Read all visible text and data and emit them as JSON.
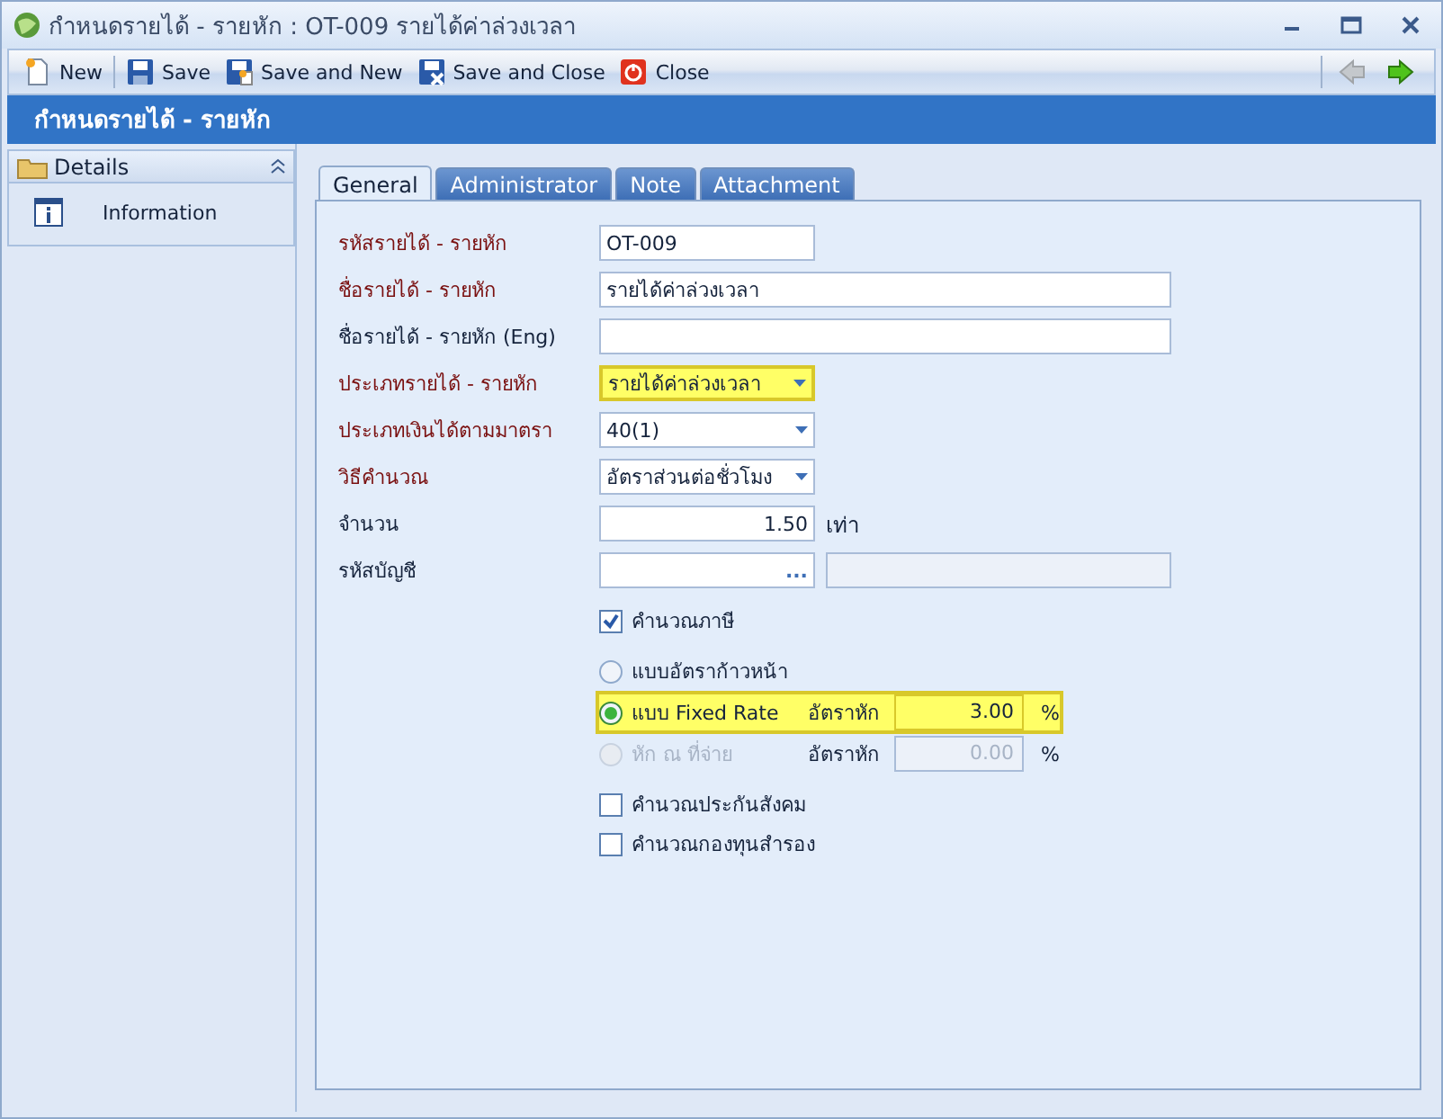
{
  "window": {
    "title": "กำหนดรายได้ - รายหัก : OT-009 รายได้ค่าล่วงเวลา"
  },
  "toolbar": {
    "buttons": [
      {
        "label": "New",
        "kind": "new"
      },
      {
        "label": "Save",
        "kind": "save"
      },
      {
        "label": "Save and New",
        "kind": "save-new"
      },
      {
        "label": "Save and Close",
        "kind": "save-close"
      },
      {
        "label": "Close",
        "kind": "close"
      }
    ],
    "nav": [
      {
        "kind": "back",
        "disabled": true
      },
      {
        "kind": "forward",
        "disabled": false
      }
    ]
  },
  "header": {
    "title": "กำหนดรายได้ - รายหัก"
  },
  "sidebar": {
    "group": "Details",
    "items": [
      {
        "label": "Information"
      }
    ]
  },
  "tabs": [
    {
      "label": "General",
      "selected": true
    },
    {
      "label": "Administrator",
      "selected": false
    },
    {
      "label": "Note",
      "selected": false
    },
    {
      "label": "Attachment",
      "selected": false
    }
  ],
  "fields": [
    {
      "label": "รหัสรายได้ - รายหัก",
      "required": true,
      "kind": "code",
      "value": "OT-009",
      "highlighted": false
    },
    {
      "label": "ชื่อรายได้ - รายหัก",
      "required": true,
      "kind": "text",
      "value": "รายได้ค่าล่วงเวลา",
      "highlighted": false
    },
    {
      "label": "ชื่อรายได้ - รายหัก (Eng)",
      "required": false,
      "kind": "text",
      "highlighted": false
    },
    {
      "label": "ประเภทรายได้ - รายหัก",
      "required": true,
      "kind": "combo",
      "value": "รายได้ค่าล่วงเวลา",
      "highlighted": true
    },
    {
      "label": "ประเภทเงินได้ตามมาตรา",
      "required": true,
      "kind": "combo",
      "value": "40(1)",
      "highlighted": false
    },
    {
      "label": "วิธีคำนวณ",
      "required": true,
      "kind": "combo",
      "value": "อัตราส่วนต่อชั่วโมง",
      "highlighted": false
    },
    {
      "label": "จำนวน",
      "required": false,
      "kind": "number",
      "value": "1.50",
      "unit": "เท่า",
      "highlighted": false
    },
    {
      "label": "รหัสบัญชี",
      "required": false,
      "kind": "lookup",
      "button": "...",
      "highlighted": false
    }
  ],
  "options": [
    {
      "kind": "checkbox",
      "label": "คำนวณภาษี",
      "checked": true
    },
    {
      "kind": "radio",
      "label": "แบบอัตราก้าวหน้า",
      "selected": false,
      "disabled": false,
      "highlighted": false
    },
    {
      "kind": "radio",
      "label": "แบบ Fixed Rate",
      "selected": true,
      "disabled": false,
      "highlighted": true,
      "rate_label": "อัตราหัก",
      "rate": "3.00",
      "unit": "%"
    },
    {
      "kind": "radio",
      "label": "หัก ณ ที่จ่าย",
      "selected": false,
      "disabled": true,
      "highlighted": false,
      "rate_label": "อัตราหัก",
      "rate": "0.00",
      "unit": "%"
    },
    {
      "kind": "checkbox",
      "label": "คำนวณประกันสังคม",
      "checked": false
    },
    {
      "kind": "checkbox",
      "label": "คำนวณกองทุนสำรอง",
      "checked": false
    }
  ]
}
